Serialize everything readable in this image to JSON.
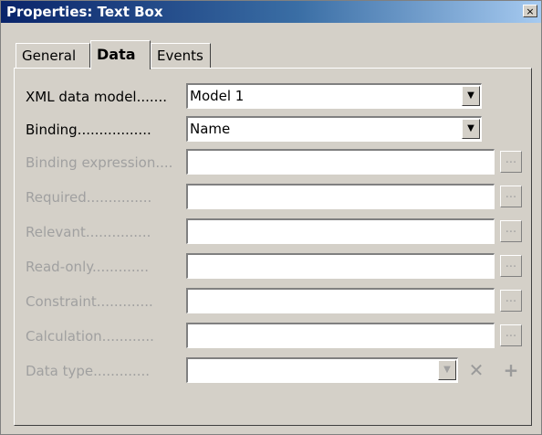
{
  "window": {
    "title": "Properties: Text Box",
    "close_label": "×"
  },
  "tabs": [
    {
      "label": "General",
      "active": false
    },
    {
      "label": "Data",
      "active": true
    },
    {
      "label": "Events",
      "active": false
    }
  ],
  "fields": {
    "xml_data_model": {
      "label": "XML data model.......",
      "value": "Model 1"
    },
    "binding": {
      "label": "Binding.................",
      "value": "Name"
    },
    "binding_expression": {
      "label": "Binding expression....",
      "value": ""
    },
    "required": {
      "label": "Required...............",
      "value": ""
    },
    "relevant": {
      "label": "Relevant...............",
      "value": ""
    },
    "read_only": {
      "label": "Read-only.............",
      "value": ""
    },
    "constraint": {
      "label": "Constraint.............",
      "value": ""
    },
    "calculation": {
      "label": "Calculation............",
      "value": ""
    },
    "data_type": {
      "label": "Data type.............",
      "value": ""
    }
  },
  "buttons": {
    "ellipsis_label": "...",
    "dropdown_arrow": "▼",
    "delete_label": "✕",
    "add_label": "+"
  }
}
